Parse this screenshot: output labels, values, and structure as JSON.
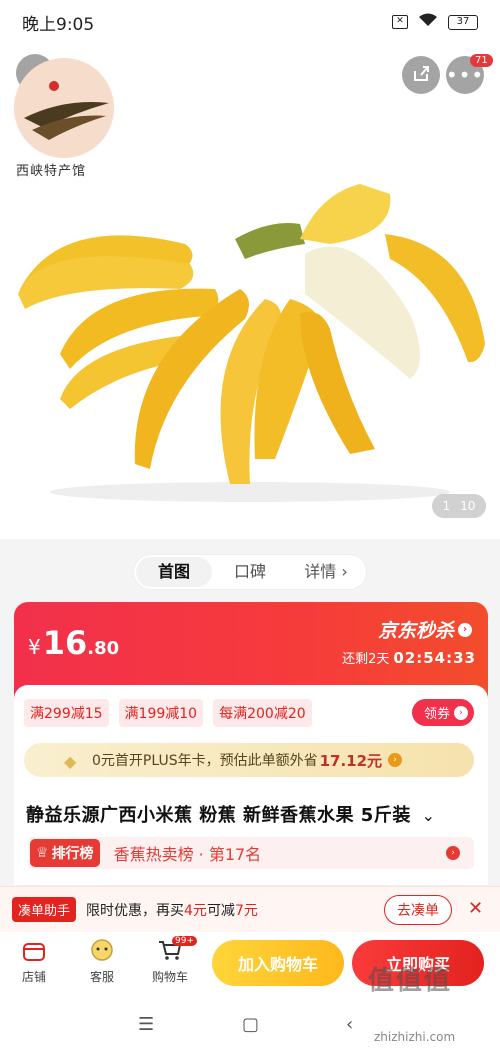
{
  "status_bar": {
    "time": "晚上9:05",
    "battery": "37"
  },
  "top_nav": {
    "more_badge": "71"
  },
  "shop": {
    "logo_text": "西峡特产馆"
  },
  "gallery": {
    "current": "1",
    "total": "10"
  },
  "tabs": [
    {
      "label": "首图",
      "active": true
    },
    {
      "label": "口碑",
      "active": false
    },
    {
      "label": "详情 ›",
      "active": false
    }
  ],
  "price": {
    "symbol": "¥",
    "integer": "16",
    "decimal": ".80"
  },
  "seckill": {
    "label": "京东秒杀",
    "remaining_label": "还剩2天",
    "countdown": "02:54:33"
  },
  "coupons": [
    "满299减15",
    "满199减10",
    "每满200减20"
  ],
  "claim_label": "领券",
  "plus_banner": {
    "text": "0元首开PLUS年卡，预估此单额外省",
    "amount": "17.12元"
  },
  "product": {
    "title": "静益乐源广西小米蕉 粉蕉 新鲜香蕉水果 5斤装"
  },
  "ranking": {
    "tag": "排行榜",
    "text": "香蕉热卖榜 · 第17名"
  },
  "helper": {
    "tag": "凑单助手",
    "text_prefix": "限时优惠，再买",
    "amount1": "4元",
    "text_mid": "可减",
    "amount2": "7元",
    "button": "去凑单"
  },
  "actions": {
    "store": "店铺",
    "service": "客服",
    "cart": "购物车",
    "cart_badge": "99+",
    "add_to_cart": "加入购物车",
    "buy_now": "立即购买"
  },
  "watermark": {
    "big": "值值值",
    "url": "zhizhizhi.com"
  },
  "colors": {
    "brand_red": "#e3231e",
    "seckill_red": "#f2304c",
    "cart_yellow": "#ffb81c"
  }
}
